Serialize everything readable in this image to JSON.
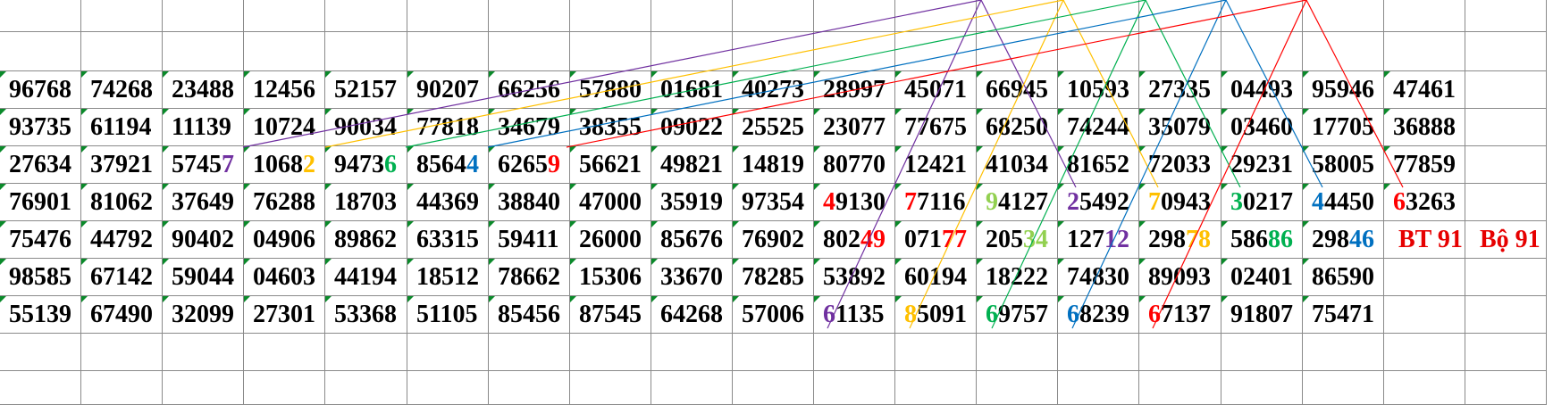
{
  "colors": {
    "purple": "#7030a0",
    "yellow": "#ffc000",
    "green": "#00b050",
    "lightgreen": "#92d050",
    "blue": "#0070c0",
    "red": "#ff0000"
  },
  "rows": [
    {
      "cells": [
        {
          "t": "96768"
        },
        {
          "t": "74268"
        },
        {
          "t": "23488"
        },
        {
          "t": "12456"
        },
        {
          "t": "52157"
        },
        {
          "t": "90207"
        },
        {
          "t": "66256"
        },
        {
          "t": "57880"
        },
        {
          "t": "01681"
        },
        {
          "t": "40273"
        },
        {
          "t": "28997"
        },
        {
          "t": "45071"
        },
        {
          "t": "66945"
        },
        {
          "t": "10593"
        },
        {
          "t": "27335"
        },
        {
          "t": "04493"
        },
        {
          "t": "95946"
        },
        {
          "t": "47461"
        }
      ]
    },
    {
      "cells": [
        {
          "t": "93735"
        },
        {
          "t": "61194"
        },
        {
          "t": "11139"
        },
        {
          "t": "10724"
        },
        {
          "t": "90034"
        },
        {
          "t": "77818"
        },
        {
          "t": "34679"
        },
        {
          "t": "38355"
        },
        {
          "t": "09022"
        },
        {
          "t": "25525"
        },
        {
          "t": "23077"
        },
        {
          "t": "77675"
        },
        {
          "t": "68250"
        },
        {
          "t": "74244"
        },
        {
          "t": "35079"
        },
        {
          "t": "03460"
        },
        {
          "t": "17705"
        },
        {
          "t": "36888"
        }
      ]
    },
    {
      "cells": [
        {
          "t": "27634"
        },
        {
          "t": "37921"
        },
        {
          "t": "57457",
          "hl": {
            "pos": 4,
            "len": 1,
            "color": "purple"
          }
        },
        {
          "t": "10682",
          "hl": {
            "pos": 4,
            "len": 1,
            "color": "yellow"
          }
        },
        {
          "t": "94736",
          "hl": {
            "pos": 4,
            "len": 1,
            "color": "green"
          }
        },
        {
          "t": "85644",
          "hl": {
            "pos": 4,
            "len": 1,
            "color": "blue"
          }
        },
        {
          "t": "62659",
          "hl": {
            "pos": 4,
            "len": 1,
            "color": "red"
          }
        },
        {
          "t": "56621"
        },
        {
          "t": "49821"
        },
        {
          "t": "14819"
        },
        {
          "t": "80770"
        },
        {
          "t": "12421"
        },
        {
          "t": "41034"
        },
        {
          "t": "81652"
        },
        {
          "t": "72033"
        },
        {
          "t": "29231"
        },
        {
          "t": "58005"
        },
        {
          "t": "77859"
        }
      ]
    },
    {
      "cells": [
        {
          "t": "76901"
        },
        {
          "t": "81062"
        },
        {
          "t": "37649"
        },
        {
          "t": "76288"
        },
        {
          "t": "18703"
        },
        {
          "t": "44369"
        },
        {
          "t": "38840"
        },
        {
          "t": "47000"
        },
        {
          "t": "35919"
        },
        {
          "t": "97354"
        },
        {
          "t": "49130",
          "hl": {
            "pos": 0,
            "len": 1,
            "color": "red"
          }
        },
        {
          "t": "77116",
          "hl": {
            "pos": 0,
            "len": 1,
            "color": "red"
          }
        },
        {
          "t": "94127",
          "hl": {
            "pos": 0,
            "len": 1,
            "color": "lightgreen"
          }
        },
        {
          "t": "25492",
          "hl": {
            "pos": 0,
            "len": 1,
            "color": "purple"
          }
        },
        {
          "t": "70943",
          "hl": {
            "pos": 0,
            "len": 1,
            "color": "yellow"
          }
        },
        {
          "t": "30217",
          "hl": {
            "pos": 0,
            "len": 1,
            "color": "green"
          }
        },
        {
          "t": "44450",
          "hl": {
            "pos": 0,
            "len": 1,
            "color": "blue"
          }
        },
        {
          "t": "63263",
          "hl": {
            "pos": 0,
            "len": 1,
            "color": "red"
          }
        }
      ]
    },
    {
      "cells": [
        {
          "t": "75476"
        },
        {
          "t": "44792"
        },
        {
          "t": "90402"
        },
        {
          "t": "04906"
        },
        {
          "t": "89862"
        },
        {
          "t": "63315"
        },
        {
          "t": "59411"
        },
        {
          "t": "26000"
        },
        {
          "t": "85676"
        },
        {
          "t": "76902"
        },
        {
          "t": "80249",
          "hl": {
            "pos": 3,
            "len": 2,
            "color": "red"
          }
        },
        {
          "t": "07177",
          "hl": {
            "pos": 3,
            "len": 2,
            "color": "red"
          }
        },
        {
          "t": "20534",
          "hl": {
            "pos": 3,
            "len": 2,
            "color": "lightgreen"
          }
        },
        {
          "t": "12712",
          "hl": {
            "pos": 3,
            "len": 2,
            "color": "purple"
          }
        },
        {
          "t": "29878",
          "hl": {
            "pos": 3,
            "len": 2,
            "color": "yellow"
          }
        },
        {
          "t": "58686",
          "hl": {
            "pos": 3,
            "len": 2,
            "color": "green"
          }
        },
        {
          "t": "29846",
          "hl": {
            "pos": 3,
            "len": 2,
            "color": "blue"
          }
        },
        {
          "t": "BT 91",
          "label": true
        },
        {
          "t": "Bộ 91",
          "label": true
        }
      ]
    },
    {
      "cells": [
        {
          "t": "98585"
        },
        {
          "t": "67142"
        },
        {
          "t": "59044"
        },
        {
          "t": "04603"
        },
        {
          "t": "44194"
        },
        {
          "t": "18512"
        },
        {
          "t": "78662"
        },
        {
          "t": "15306"
        },
        {
          "t": "33670"
        },
        {
          "t": "78285"
        },
        {
          "t": "53892"
        },
        {
          "t": "60194"
        },
        {
          "t": "18222"
        },
        {
          "t": "74830"
        },
        {
          "t": "89093"
        },
        {
          "t": "02401"
        },
        {
          "t": "86590"
        }
      ]
    },
    {
      "cells": [
        {
          "t": "55139"
        },
        {
          "t": "67490"
        },
        {
          "t": "32099"
        },
        {
          "t": "27301"
        },
        {
          "t": "53368"
        },
        {
          "t": "51105"
        },
        {
          "t": "85456"
        },
        {
          "t": "87545"
        },
        {
          "t": "64268"
        },
        {
          "t": "57006"
        },
        {
          "t": "61135",
          "hl": {
            "pos": 0,
            "len": 1,
            "color": "purple"
          }
        },
        {
          "t": "85091",
          "hl": {
            "pos": 0,
            "len": 1,
            "color": "yellow"
          }
        },
        {
          "t": "69757",
          "hl": {
            "pos": 0,
            "len": 1,
            "color": "green"
          }
        },
        {
          "t": "68239",
          "hl": {
            "pos": 0,
            "len": 1,
            "color": "blue"
          }
        },
        {
          "t": "67137",
          "hl": {
            "pos": 0,
            "len": 1,
            "color": "red"
          }
        },
        {
          "t": "91807"
        },
        {
          "t": "75471"
        }
      ]
    }
  ]
}
